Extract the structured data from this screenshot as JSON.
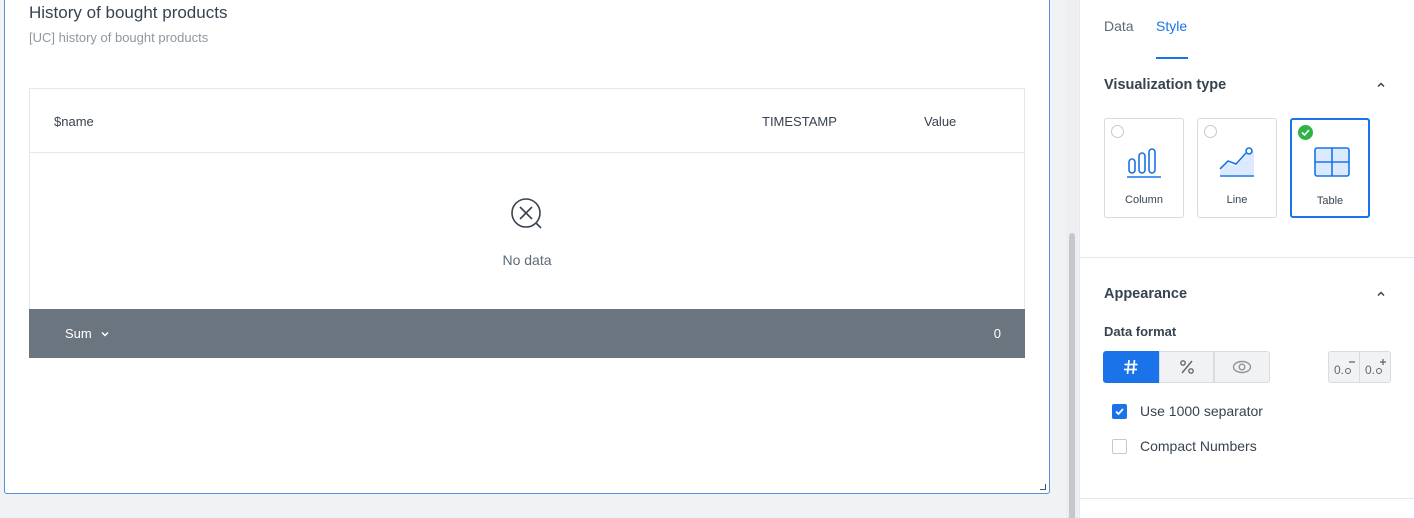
{
  "widget": {
    "title": "History of bought products",
    "subtitle": "[UC] history of bought products",
    "table": {
      "columns": [
        "$name",
        "TIMESTAMP",
        "Value"
      ],
      "empty_text": "No data",
      "summary": {
        "aggregation": "Sum",
        "value": "0"
      }
    }
  },
  "panel": {
    "tabs": [
      {
        "label": "Data",
        "active": false
      },
      {
        "label": "Style",
        "active": true
      }
    ],
    "visualization": {
      "title": "Visualization type",
      "options": [
        {
          "label": "Column",
          "icon": "column-chart-icon",
          "selected": false
        },
        {
          "label": "Line",
          "icon": "line-chart-icon",
          "selected": false
        },
        {
          "label": "Table",
          "icon": "table-icon",
          "selected": true
        }
      ]
    },
    "appearance": {
      "title": "Appearance",
      "data_format_label": "Data format",
      "formats": [
        {
          "icon": "hash-icon",
          "active": true
        },
        {
          "icon": "percent-icon",
          "active": false
        },
        {
          "icon": "eye-icon",
          "active": false
        }
      ],
      "decimal_buttons": [
        "decrease-decimals-icon",
        "increase-decimals-icon"
      ],
      "checkboxes": [
        {
          "label": "Use 1000 separator",
          "checked": true
        },
        {
          "label": "Compact Numbers",
          "checked": false
        }
      ]
    }
  },
  "colors": {
    "accent": "#1a73e8",
    "summary_bar": "#6a7580",
    "success": "#2fb344",
    "widget_border": "#5b8fd9"
  }
}
